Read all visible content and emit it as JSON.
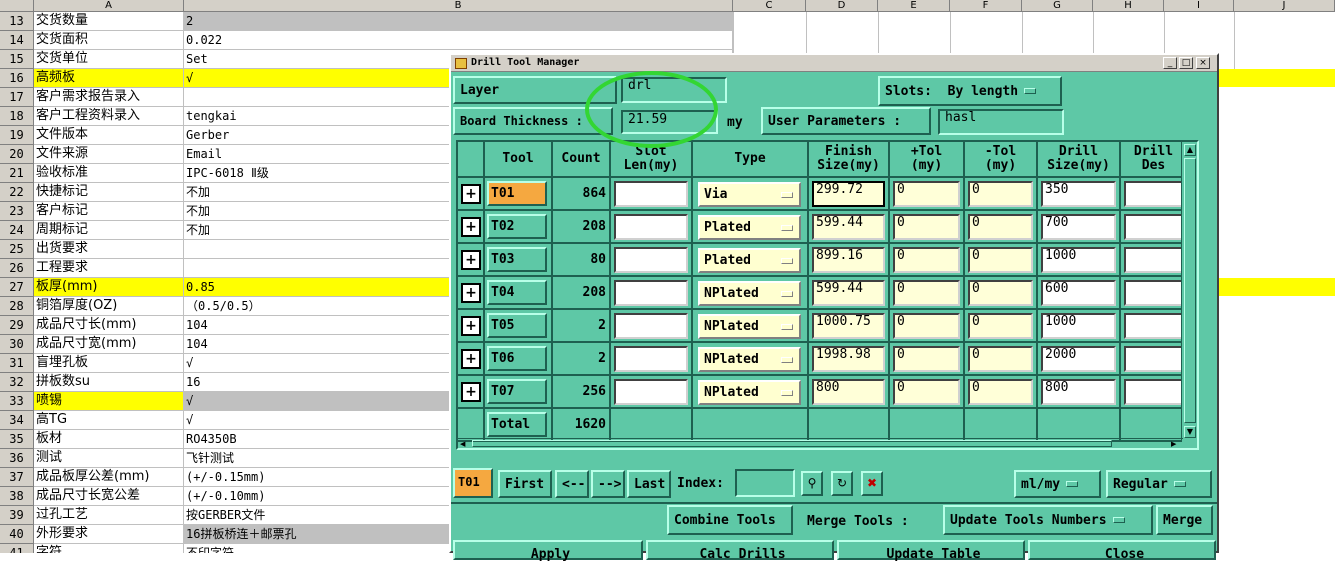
{
  "sheet": {
    "columns": [
      "A",
      "B",
      "C",
      "D",
      "E",
      "F",
      "G",
      "H",
      "I",
      "J"
    ],
    "rows": [
      {
        "n": "13",
        "a": "交货数量",
        "b": "2",
        "a_bg": "",
        "b_bg": "gray"
      },
      {
        "n": "14",
        "a": "交货面积",
        "b": "0.022",
        "a_bg": "",
        "b_bg": ""
      },
      {
        "n": "15",
        "a": "交货单位",
        "b": "Set",
        "a_bg": "",
        "b_bg": ""
      },
      {
        "n": "16",
        "a": "高频板",
        "b": "√",
        "a_bg": "yellow",
        "b_bg": "yellow"
      },
      {
        "n": "17",
        "a": "客户需求报告录入",
        "b": "",
        "a_bg": "",
        "b_bg": ""
      },
      {
        "n": "18",
        "a": "客户工程资料录入",
        "b": "tengkai",
        "a_bg": "",
        "b_bg": ""
      },
      {
        "n": "19",
        "a": "文件版本",
        "b": "Gerber",
        "a_bg": "",
        "b_bg": ""
      },
      {
        "n": "20",
        "a": "文件来源",
        "b": "Email",
        "a_bg": "",
        "b_bg": ""
      },
      {
        "n": "21",
        "a": "验收标准",
        "b": "IPC-6018 Ⅱ级",
        "a_bg": "",
        "b_bg": ""
      },
      {
        "n": "22",
        "a": "快捷标记",
        "b": "不加",
        "a_bg": "",
        "b_bg": ""
      },
      {
        "n": "23",
        "a": "客户标记",
        "b": "不加",
        "a_bg": "",
        "b_bg": ""
      },
      {
        "n": "24",
        "a": "周期标记",
        "b": "不加",
        "a_bg": "",
        "b_bg": ""
      },
      {
        "n": "25",
        "a": "出货要求",
        "b": "",
        "a_bg": "",
        "b_bg": ""
      },
      {
        "n": "26",
        "a": "工程要求",
        "b": "",
        "a_bg": "",
        "b_bg": ""
      },
      {
        "n": "27",
        "a": "板厚(mm)",
        "b": "0.85",
        "a_bg": "yellow",
        "b_bg": "yellow"
      },
      {
        "n": "28",
        "a": "铜箔厚度(OZ)",
        "b": "（0.5/0.5）",
        "a_bg": "",
        "b_bg": ""
      },
      {
        "n": "29",
        "a": "成品尺寸长(mm)",
        "b": "104",
        "a_bg": "",
        "b_bg": ""
      },
      {
        "n": "30",
        "a": "成品尺寸宽(mm)",
        "b": "104",
        "a_bg": "",
        "b_bg": ""
      },
      {
        "n": "31",
        "a": "盲埋孔板",
        "b": "√",
        "a_bg": "",
        "b_bg": ""
      },
      {
        "n": "32",
        "a": "拼板数su",
        "b": "16",
        "a_bg": "",
        "b_bg": ""
      },
      {
        "n": "33",
        "a": "喷锡",
        "b": "√",
        "a_bg": "yellow",
        "b_bg": "gray"
      },
      {
        "n": "34",
        "a": "高TG",
        "b": "√",
        "a_bg": "",
        "b_bg": ""
      },
      {
        "n": "35",
        "a": "板材",
        "b": "RO4350B",
        "a_bg": "",
        "b_bg": ""
      },
      {
        "n": "36",
        "a": "测试",
        "b": "飞针测试",
        "a_bg": "",
        "b_bg": ""
      },
      {
        "n": "37",
        "a": "成品板厚公差(mm)",
        "b": "(+/-0.15mm)",
        "a_bg": "",
        "b_bg": ""
      },
      {
        "n": "38",
        "a": "成品尺寸长宽公差",
        "b": "(+/-0.10mm)",
        "a_bg": "",
        "b_bg": ""
      },
      {
        "n": "39",
        "a": "过孔工艺",
        "b": "按GERBER文件",
        "a_bg": "",
        "b_bg": ""
      },
      {
        "n": "40",
        "a": "外形要求",
        "b": "16拼板桥连＋邮票孔",
        "a_bg": "",
        "b_bg": "gray"
      },
      {
        "n": "41",
        "a": "字符",
        "b": "不印字符",
        "a_bg": "",
        "b_bg": ""
      }
    ]
  },
  "dialog": {
    "title": "Drill Tool Manager",
    "title_buttons": [
      "_",
      "□",
      "×"
    ],
    "layer_label": "Layer",
    "layer_value": "drl",
    "slots_label": "Slots:",
    "slots_value": "By length",
    "board_thickness_label": "Board Thickness :",
    "board_thickness_value": "21.59",
    "board_thickness_unit": "my",
    "user_params_label": "User Parameters :",
    "user_params_value": "hasl",
    "headers": [
      "",
      "Tool",
      "Count",
      "Slot\nLen(my)",
      "Type",
      "Finish\nSize(my)",
      "+Tol\n(my)",
      "-Tol\n(my)",
      "Drill\nSize(my)",
      "Drill\nDes"
    ],
    "rows": [
      {
        "tool": "T01",
        "count": "864",
        "slot": "",
        "type": "Via",
        "finish": "299.72",
        "ptol": "0",
        "mtol": "0",
        "drill": "350",
        "des": ""
      },
      {
        "tool": "T02",
        "count": "208",
        "slot": "",
        "type": "Plated",
        "finish": "599.44",
        "ptol": "0",
        "mtol": "0",
        "drill": "700",
        "des": ""
      },
      {
        "tool": "T03",
        "count": "80",
        "slot": "",
        "type": "Plated",
        "finish": "899.16",
        "ptol": "0",
        "mtol": "0",
        "drill": "1000",
        "des": ""
      },
      {
        "tool": "T04",
        "count": "208",
        "slot": "",
        "type": "NPlated",
        "finish": "599.44",
        "ptol": "0",
        "mtol": "0",
        "drill": "600",
        "des": ""
      },
      {
        "tool": "T05",
        "count": "2",
        "slot": "",
        "type": "NPlated",
        "finish": "1000.75",
        "ptol": "0",
        "mtol": "0",
        "drill": "1000",
        "des": ""
      },
      {
        "tool": "T06",
        "count": "2",
        "slot": "",
        "type": "NPlated",
        "finish": "1998.98",
        "ptol": "0",
        "mtol": "0",
        "drill": "2000",
        "des": ""
      },
      {
        "tool": "T07",
        "count": "256",
        "slot": "",
        "type": "NPlated",
        "finish": "800",
        "ptol": "0",
        "mtol": "0",
        "drill": "800",
        "des": ""
      }
    ],
    "total_label": "Total",
    "total_count": "1620",
    "current_tool": "T01",
    "nav": {
      "first": "First",
      "prev": "<--",
      "next": "-->",
      "last": "Last",
      "index_label": "Index:",
      "index_value": ""
    },
    "units_value": "ml/my",
    "mode_value": "Regular",
    "combine_tools": "Combine Tools",
    "merge_tools_label": "Merge Tools :",
    "merge_option": "Update Tools Numbers",
    "merge": "Merge",
    "apply": "Apply",
    "calc_drills": "Calc Drills",
    "update_table": "Update Table",
    "close": "Close",
    "colors": {
      "bg": "#5ec8a6",
      "selected_tool": "#f5a840",
      "highlight": "#33d633"
    }
  }
}
